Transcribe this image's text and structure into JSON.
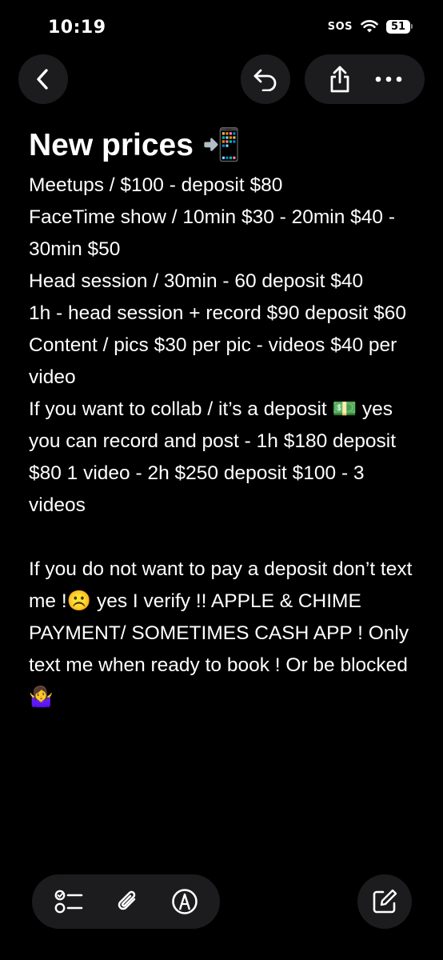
{
  "status_bar": {
    "time": "10:19",
    "sos": "SOS",
    "battery": "51"
  },
  "toolbar": {
    "back_icon": "chevron-left-icon",
    "undo_icon": "undo-icon",
    "share_icon": "share-icon",
    "more_icon": "more-icon"
  },
  "note": {
    "title": "New prices 📲",
    "lines": [
      "Meetups / $100 - deposit $80",
      "FaceTime show /  10min $30 - 20min $40 - 30min $50",
      "Head session / 30min - 60 deposit $40",
      "1h - head session + record $90 deposit $60",
      "Content /  pics $30 per pic - videos $40 per video",
      "If you want to collab / it’s a deposit 💵 yes you can record and post - 1h $180 deposit $80  1 video - 2h $250 deposit $100 - 3 videos",
      "",
      "If you do not want to pay a deposit don’t text me !☹️ yes I verify !! APPLE & CHIME PAYMENT/ SOMETIMES CASH APP ! Only text me when ready to book ! Or be blocked 🤷‍♀️"
    ]
  },
  "bottom_toolbar": {
    "checklist_icon": "checklist-icon",
    "attachment_icon": "paperclip-icon",
    "markup_icon": "markup-pen-icon",
    "compose_icon": "compose-icon"
  },
  "colors": {
    "background": "#000000",
    "button_bg": "#1c1c1e",
    "text": "#ffffff"
  }
}
